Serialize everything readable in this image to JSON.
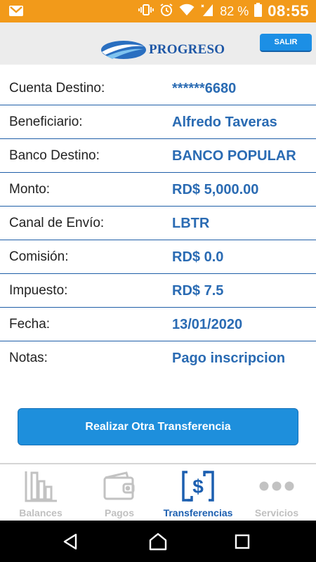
{
  "status_bar": {
    "battery": "82 %",
    "time": "08:55"
  },
  "header": {
    "brand": "PROGRESO",
    "logout_label": "SALIR"
  },
  "details": [
    {
      "label": "Cuenta Destino:",
      "value": "******6680"
    },
    {
      "label": "Beneficiario:",
      "value": "Alfredo Taveras"
    },
    {
      "label": "Banco Destino:",
      "value": "BANCO POPULAR"
    },
    {
      "label": "Monto:",
      "value": "RD$ 5,000.00"
    },
    {
      "label": "Canal de Envío:",
      "value": "LBTR"
    },
    {
      "label": "Comisión:",
      "value": "RD$ 0.0"
    },
    {
      "label": "Impuesto:",
      "value": "RD$ 7.5"
    },
    {
      "label": "Fecha:",
      "value": "13/01/2020"
    },
    {
      "label": "Notas:",
      "value": "Pago inscripcion"
    }
  ],
  "action": {
    "label": "Realizar Otra Transferencia"
  },
  "tabs": [
    {
      "label": "Balances",
      "icon": "bar-chart-icon",
      "active": false
    },
    {
      "label": "Pagos",
      "icon": "wallet-icon",
      "active": false
    },
    {
      "label": "Transferencias",
      "icon": "transfer-icon",
      "active": true
    },
    {
      "label": "Servicios",
      "icon": "more-dots-icon",
      "active": false
    }
  ],
  "colors": {
    "status_bar": "#f29a1a",
    "accent": "#1e8fdc",
    "value_text": "#2a6bb3",
    "active_tab": "#1c5fb0",
    "inactive_tab": "#c0c0c0"
  }
}
